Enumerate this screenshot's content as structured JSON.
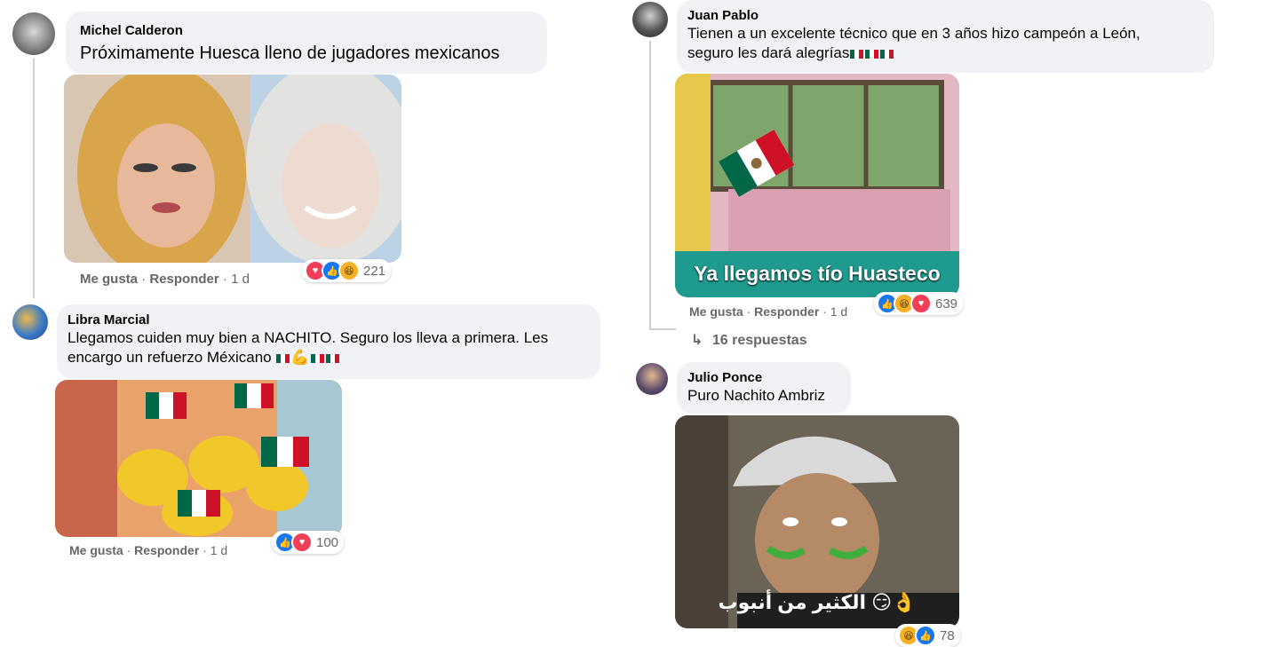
{
  "comments": [
    {
      "author": "Michel Calderon",
      "text": "Próximamente Huesca lleno de jugadores mexicanos",
      "like": "Me gusta",
      "reply": "Responder",
      "time": "1 d",
      "reaction_count": "221",
      "reactions": [
        "love-icon",
        "like-icon",
        "haha-icon"
      ]
    },
    {
      "author": "Libra Marcial",
      "text_line1": "Llegamos cuiden muy bien a NACHITO. Seguro los lleva a primera. Les",
      "text_line2": "encargo un refuerzo Méxicano",
      "like": "Me gusta",
      "reply": "Responder",
      "time": "1 d",
      "reaction_count": "100",
      "reactions": [
        "like-icon",
        "love-icon"
      ]
    },
    {
      "author": "Juan Pablo",
      "text_line1": "Tienen a un excelente técnico que en 3 años hizo campeón a León,",
      "text_line2": "seguro les dará alegrías",
      "image_caption": "Ya llegamos tío Huasteco",
      "like": "Me gusta",
      "reply": "Responder",
      "time": "1 d",
      "reaction_count": "639",
      "reactions": [
        "like-icon",
        "haha-icon",
        "love-icon"
      ],
      "replies_label": "16 respuestas"
    },
    {
      "author": "Julio Ponce",
      "text": "Puro Nachito Ambriz",
      "image_caption": "الكثير من أنبوب",
      "reaction_count": "78",
      "reactions": [
        "haha-icon",
        "like-icon"
      ]
    }
  ],
  "colors": {
    "bubble": "#f0f2f5",
    "secondary_text": "#65676b",
    "like_blue": "#1877f2",
    "love_red": "#f33e58",
    "haha_yellow": "#f7b125"
  }
}
